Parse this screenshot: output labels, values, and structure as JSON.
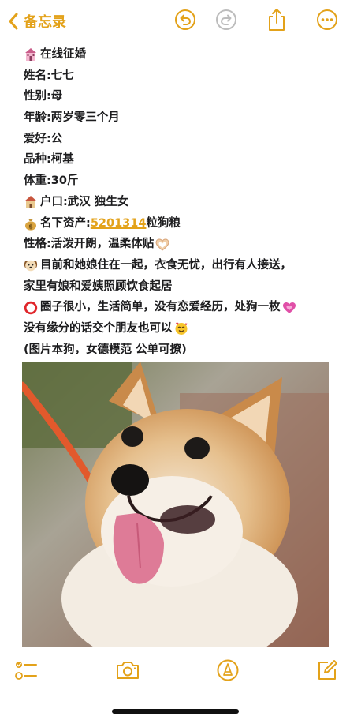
{
  "header": {
    "back_label": "备忘录"
  },
  "note": {
    "lines": [
      {
        "icon": "wedding-chapel-icon",
        "text": "在线征婚"
      },
      {
        "icon": "",
        "text": "姓名:七七"
      },
      {
        "icon": "",
        "text": "性别:母"
      },
      {
        "icon": "",
        "text": "年龄:两岁零三个月"
      },
      {
        "icon": "",
        "text": "爱好:公"
      },
      {
        "icon": "",
        "text": "品种:柯基"
      },
      {
        "icon": "",
        "text": "体重:30斤"
      },
      {
        "icon": "house-icon",
        "text": "户口:武汉 独生女"
      },
      {
        "icon": "money-bag-icon",
        "text_before": "名下资产:",
        "link": "5201314",
        "text_after": "粒狗粮"
      },
      {
        "icon": "",
        "text": "性格:活泼开朗，温柔体贴",
        "trail_icon": "heart-hands-icon"
      },
      {
        "icon": "dog-face-icon",
        "text": "目前和她娘住在一起，衣食无忧，出行有人接送，"
      },
      {
        "icon": "",
        "text": "家里有娘和爱姨照顾饮食起居"
      },
      {
        "icon": "red-circle-icon",
        "text": "圈子很小，生活简单，没有恋爱经历，处狗一枚",
        "trail_icon": "growing-heart-icon"
      },
      {
        "icon": "",
        "text": "没有缘分的话交个朋友也可以",
        "trail_icon": "smiling-face-with-hearts-icon"
      },
      {
        "icon": "",
        "text": "(图片本狗，女德模范 公单可撩)"
      }
    ]
  },
  "colors": {
    "accent": "#e3a21a",
    "text": "#1c1c1e"
  }
}
